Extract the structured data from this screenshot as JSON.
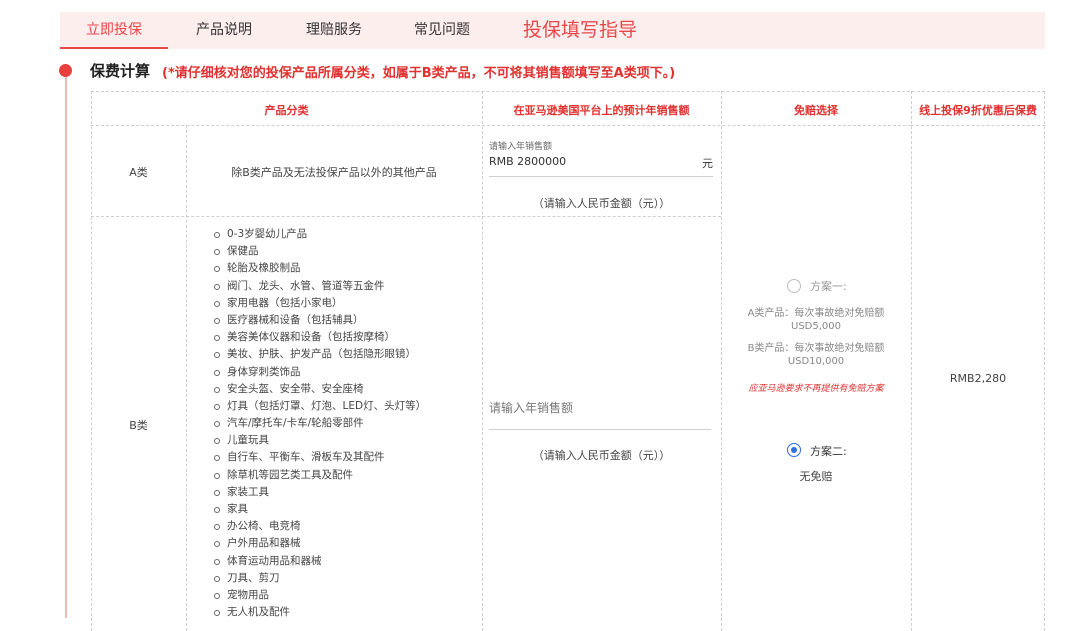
{
  "tabs": [
    {
      "label": "立即投保",
      "active": true
    },
    {
      "label": "产品说明",
      "active": false
    },
    {
      "label": "理赔服务",
      "active": false
    },
    {
      "label": "常见问题",
      "active": false
    }
  ],
  "guide_tab": "投保填写指导",
  "section": {
    "title": "保费计算",
    "note": "(*请仔细核对您的投保产品所属分类，如属于B类产品，不可将其销售额填写至A类项下。)"
  },
  "table": {
    "headers": {
      "category": "产品分类",
      "sales": "在亚马逊美国平台上的预计年销售额",
      "deductible": "免赔选择",
      "premium": "线上投保9折优惠后保费"
    },
    "row_a": {
      "label": "A类",
      "desc": "除B类产品及无法投保产品以外的其他产品",
      "input_label": "请输入年销售额",
      "input_value": "RMB 2800000",
      "unit": "元",
      "hint": "（请输入人民币金额（元））"
    },
    "row_b": {
      "label": "B类",
      "items": [
        "0-3岁婴幼儿产品",
        "保健品",
        "轮胎及橡胶制品",
        "阀门、龙头、水管、管道等五金件",
        "家用电器（包括小家电）",
        "医疗器械和设备（包括辅具）",
        "美容美体仪器和设备（包括按摩椅）",
        "美妆、护肤、护发产品（包括隐形眼镜）",
        "身体穿刺类饰品",
        "安全头盔、安全带、安全座椅",
        "灯具（包括灯罩、灯泡、LED灯、头灯等）",
        "汽车/摩托车/卡车/轮船零部件",
        "儿童玩具",
        "自行车、平衡车、滑板车及其配件",
        "除草机等园艺类工具及配件",
        "家装工具",
        "家具",
        "办公椅、电竞椅",
        "户外用品和器械",
        "体育运动用品和器械",
        "刀具、剪刀",
        "宠物用品",
        "无人机及配件"
      ],
      "input_placeholder": "请输入年销售额",
      "hint": "（请输入人民币金额（元））"
    },
    "deductible": {
      "option1": {
        "label": "方案一:",
        "checked": false,
        "a_line": "A类产品：每次事故绝对免赔额",
        "a_amount": "USD5,000",
        "b_line": "B类产品：每次事故绝对免赔额",
        "b_amount": "USD10,000",
        "warning": "应亚马逊要求不再提供有免赔方案"
      },
      "option2": {
        "label": "方案二:",
        "checked": true,
        "desc": "无免赔"
      }
    },
    "premium": "RMB2,280"
  },
  "colors": {
    "accent": "#e8474a",
    "tab_bg": "#fdeeee",
    "radio_checked": "#2d6fe0"
  }
}
